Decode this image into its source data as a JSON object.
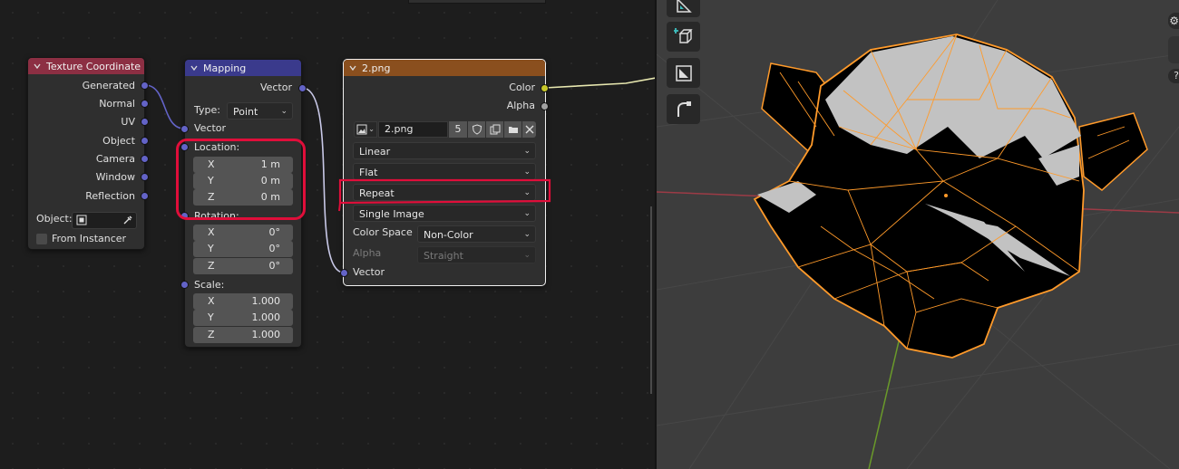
{
  "texture_coordinate": {
    "title": "Texture Coordinate",
    "outputs": [
      "Generated",
      "Normal",
      "UV",
      "Object",
      "Camera",
      "Window",
      "Reflection"
    ],
    "object_label": "Object:",
    "from_instancer": "From Instancer"
  },
  "mapping": {
    "title": "Mapping",
    "output_vector": "Vector",
    "type_label": "Type:",
    "type_value": "Point",
    "input_vector": "Vector",
    "location_label": "Location:",
    "location": [
      {
        "axis": "X",
        "value": "1 m"
      },
      {
        "axis": "Y",
        "value": "0 m"
      },
      {
        "axis": "Z",
        "value": "0 m"
      }
    ],
    "rotation_label": "Rotation:",
    "rotation": [
      {
        "axis": "X",
        "value": "0°"
      },
      {
        "axis": "Y",
        "value": "0°"
      },
      {
        "axis": "Z",
        "value": "0°"
      }
    ],
    "scale_label": "Scale:",
    "scale": [
      {
        "axis": "X",
        "value": "1.000"
      },
      {
        "axis": "Y",
        "value": "1.000"
      },
      {
        "axis": "Z",
        "value": "1.000"
      }
    ]
  },
  "image_texture": {
    "title": "2.png",
    "out_color": "Color",
    "out_alpha": "Alpha",
    "image_name": "2.png",
    "users": "5",
    "interpolation": "Linear",
    "projection": "Flat",
    "extension": "Repeat",
    "source": "Single Image",
    "color_space_label": "Color Space",
    "color_space": "Non-Color",
    "alpha_label": "Alpha",
    "alpha_mode": "Straight",
    "input_vector": "Vector"
  },
  "colors": {
    "tex_coord_header": "#8c2f43",
    "mapping_header": "#3a3a8c",
    "image_header": "#8a4f1e",
    "annotation": "#e00e3a",
    "wire_orange": "#ff9a2a"
  },
  "viewport_tools": [
    "measure-icon",
    "add-cube-icon",
    "transform-icon",
    "shear-icon"
  ]
}
